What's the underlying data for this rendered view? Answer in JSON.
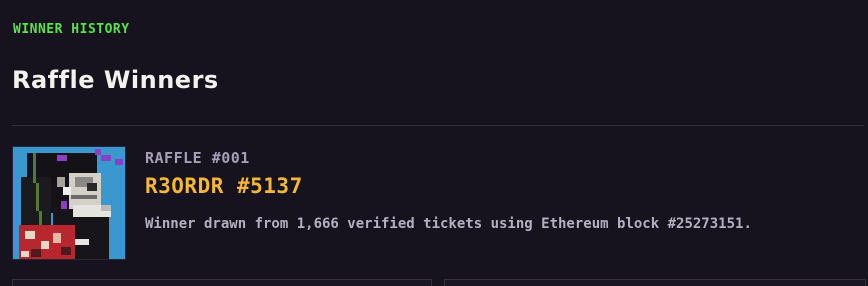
{
  "header": {
    "eyebrow": "WINNER HISTORY",
    "title": "Raffle Winners"
  },
  "winners": [
    {
      "raffle_label": "RAFFLE #001",
      "name": "R3ORDR #5137",
      "description": "Winner drawn from 1,666 verified tickets using Ethereum block #25273151.",
      "avatar_icon": "pixel-art-avatar"
    }
  ],
  "colors": {
    "background": "#16131f",
    "eyebrow": "#5de04f",
    "winner_name": "#f5b63a",
    "avatar_bg": "#3a98cf"
  }
}
